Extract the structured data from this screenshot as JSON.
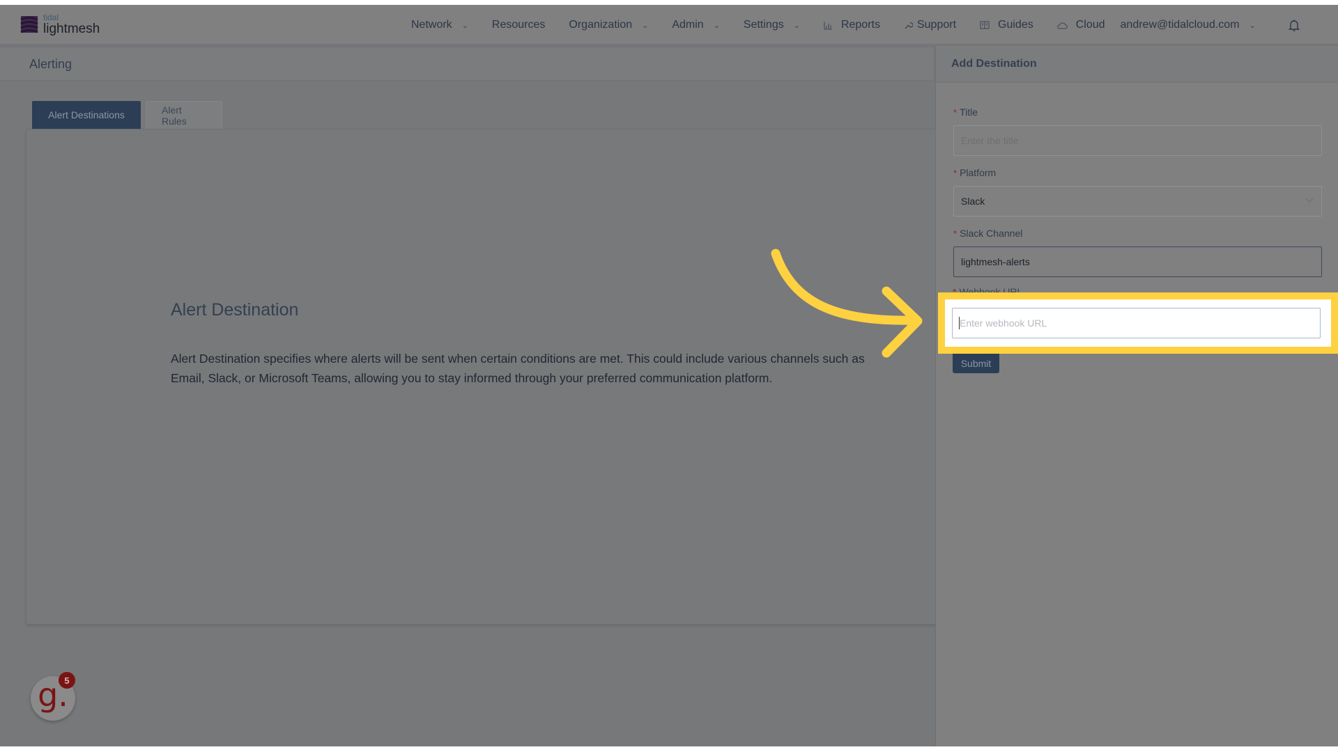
{
  "brand": {
    "small": "tidal",
    "big": "lightmesh"
  },
  "nav": {
    "items": [
      {
        "label": "Network",
        "has_dropdown": true,
        "icon": null
      },
      {
        "label": "Resources",
        "has_dropdown": false,
        "icon": null
      },
      {
        "label": "Organization",
        "has_dropdown": true,
        "icon": null
      },
      {
        "label": "Admin",
        "has_dropdown": true,
        "icon": null
      },
      {
        "label": "Settings",
        "has_dropdown": true,
        "icon": null
      },
      {
        "label": "Reports",
        "has_dropdown": false,
        "icon": "bar-chart-icon"
      },
      {
        "label": "Support",
        "has_dropdown": false,
        "icon": "wrench-icon"
      },
      {
        "label": "Guides",
        "has_dropdown": false,
        "icon": "book-icon"
      },
      {
        "label": "Cloud",
        "has_dropdown": false,
        "icon": "cloud-icon"
      },
      {
        "label": "andrew@tidalcloud.com",
        "has_dropdown": true,
        "icon": null
      }
    ],
    "icons": {
      "chevron": "⌄",
      "reports": "📊",
      "support": "✎",
      "guides": "📖",
      "cloud": "☁",
      "notifications": "bell-icon"
    }
  },
  "page": {
    "title": "Alerting"
  },
  "tabs": [
    {
      "label": "Alert Destinations",
      "active": true
    },
    {
      "label": "Alert Rules",
      "active": false
    }
  ],
  "content": {
    "heading": "Alert Destination",
    "description": "Alert Destination specifies where alerts will be sent when certain conditions are met. This could include various channels such as Email, Slack, or Microsoft Teams, allowing you to stay informed through your preferred communication platform."
  },
  "panel": {
    "title": "Add Destination",
    "required_marker": "*",
    "fields": {
      "title": {
        "label": "Title",
        "value": "",
        "placeholder": "Enter the title"
      },
      "platform": {
        "label": "Platform",
        "value": "Slack"
      },
      "slack_channel": {
        "label": "Slack Channel",
        "value": "lightmesh-alerts"
      },
      "webhook_url": {
        "label": "Webhook URL",
        "value": "",
        "placeholder": "Enter webhook URL"
      }
    },
    "submit_label": "Submit"
  },
  "support_badge": {
    "letter": "g.",
    "count": "5"
  },
  "colors": {
    "primary": "#2c3e55",
    "highlight": "#fed141",
    "required": "#8a2a2a",
    "badge": "#7a1414"
  }
}
